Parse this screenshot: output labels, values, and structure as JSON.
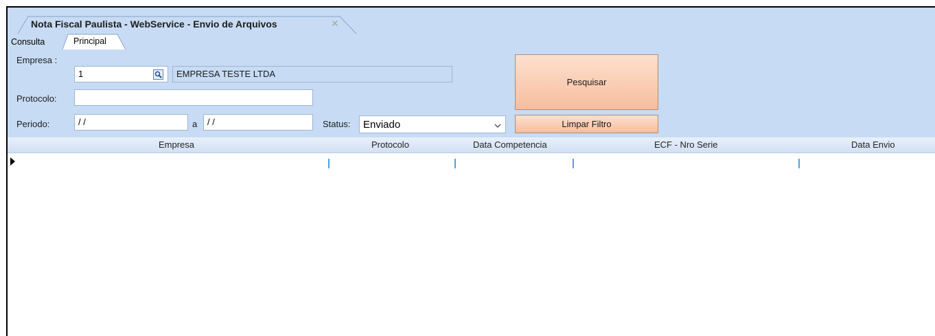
{
  "window": {
    "title": "Nota Fiscal Paulista - WebService - Envio de Arquivos",
    "close_glyph": "✕"
  },
  "tabs": [
    {
      "label": "Consulta",
      "active": true
    },
    {
      "label": "Principal",
      "active": false
    }
  ],
  "filters": {
    "empresa_label": "Empresa :",
    "empresa_code": "1",
    "empresa_name": "EMPRESA TESTE LTDA",
    "protocolo_label": "Protocolo:",
    "protocolo_value": "",
    "periodo_label": "Periodo:",
    "periodo_from": "/ /",
    "periodo_sep": "a",
    "periodo_to": "/ /",
    "status_label": "Status:",
    "status_value": "Enviado",
    "lookup_icon": "magnifier-icon",
    "dropdown_icon": "chevron-down-icon"
  },
  "buttons": {
    "search": "Pesquisar",
    "clear": "Limpar Filtro"
  },
  "grid": {
    "columns": [
      "Empresa",
      "Protocolo",
      "Data Competencia",
      "ECF - Nro Serie",
      "Data Envio"
    ],
    "rows": []
  },
  "colors": {
    "panel_bg": "#c7dcf4",
    "button_bg": "#f7bd9d",
    "separator": "#4aa3e0"
  }
}
